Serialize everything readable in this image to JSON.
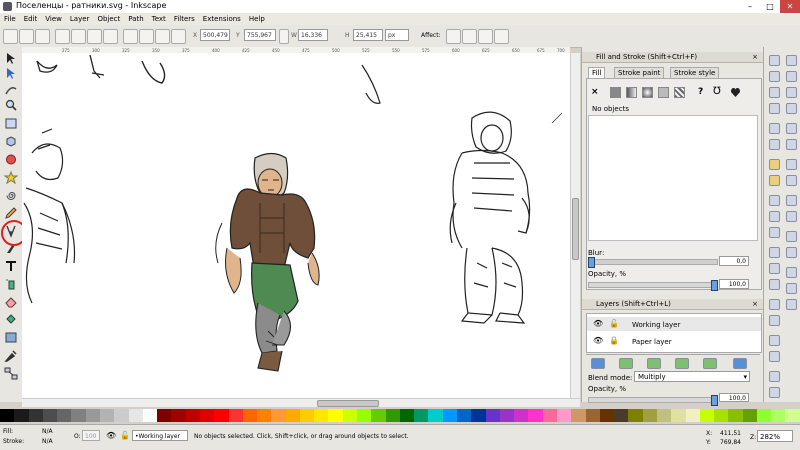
{
  "window": {
    "title": "Поселенцы - ратники.svg - Inkscape"
  },
  "menu": [
    "File",
    "Edit",
    "View",
    "Layer",
    "Object",
    "Path",
    "Text",
    "Filters",
    "Extensions",
    "Help"
  ],
  "toolbar": {
    "x_label": "X",
    "x_value": "500,479",
    "y_label": "Y",
    "y_value": "755,967",
    "w_label": "W",
    "w_value": "16,336",
    "h_label": "H",
    "h_value": "25,415",
    "units": "px",
    "affect_label": "Affect:"
  },
  "ruler": {
    "ticks": [
      "275",
      "300",
      "325",
      "350",
      "375",
      "400",
      "425",
      "450",
      "475",
      "500",
      "525",
      "550",
      "575",
      "600",
      "625",
      "650",
      "675",
      "700"
    ]
  },
  "fill_stroke": {
    "title": "Fill and Stroke (Shift+Ctrl+F)",
    "tabs": [
      "Fill",
      "Stroke paint",
      "Stroke style"
    ],
    "unset_glyph": "×",
    "unknown_glyph": "?",
    "no_objects": "No objects",
    "blur_label": "Blur:",
    "blur_value": "0,0",
    "opacity_label": "Opacity, %",
    "opacity_value": "100,0"
  },
  "layers": {
    "title": "Layers (Shift+Ctrl+L)",
    "items": [
      {
        "name": "Working layer"
      },
      {
        "name": "Paper layer"
      }
    ],
    "blend_label": "Blend mode:",
    "blend_value": "Multiply",
    "opacity_label": "Opacity, %",
    "opacity_value": "100,0"
  },
  "status": {
    "fill_label": "Fill:",
    "fill_value": "N/A",
    "stroke_label": "Stroke:",
    "stroke_value": "N/A",
    "o_label": "O:",
    "o_value": "100",
    "layer": "•Working layer",
    "message": "No objects selected. Click, Shift+click, or drag around objects to select.",
    "x_label": "X:",
    "x_value": "411,51",
    "y_label": "Y:",
    "y_value": "769,84",
    "z_label": "Z:",
    "zoom": "282%"
  },
  "colors": {
    "accent": "#3366cc",
    "highlight_ring": "#e02020",
    "palette": [
      "#000000",
      "#1a1a1a",
      "#333333",
      "#4d4d4d",
      "#666666",
      "#808080",
      "#999999",
      "#b3b3b3",
      "#cccccc",
      "#e6e6e6",
      "#ffffff",
      "#800000",
      "#a00000",
      "#c00000",
      "#e00000",
      "#ff0000",
      "#ff3333",
      "#ff6600",
      "#ff8000",
      "#ff9933",
      "#ffaa00",
      "#ffcc00",
      "#ffe600",
      "#ffff00",
      "#ccff00",
      "#99ff00",
      "#66cc00",
      "#339900",
      "#006600",
      "#009966",
      "#00cccc",
      "#0099ff",
      "#0066cc",
      "#003399",
      "#6633cc",
      "#9933cc",
      "#cc33cc",
      "#ff33cc",
      "#ff6699",
      "#ff99cc",
      "#cc9966",
      "#996633",
      "#663300",
      "#4a3b28",
      "#808000",
      "#a0a040",
      "#c0c080",
      "#e0e0a0",
      "#f0f0c0",
      "#c8ff00",
      "#a8e000",
      "#88c000",
      "#68a000",
      "#8fff2e",
      "#b0ff60",
      "#d0ff90"
    ]
  }
}
